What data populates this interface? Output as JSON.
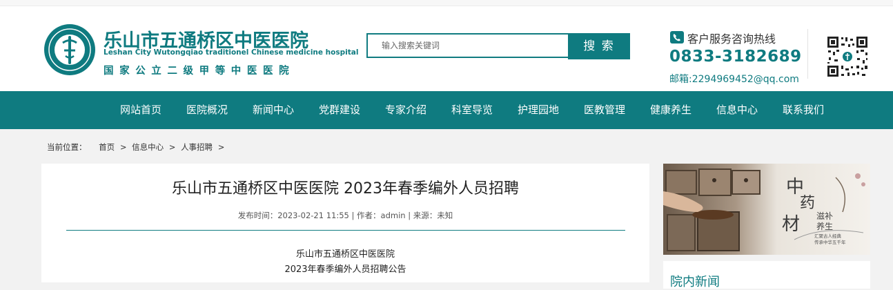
{
  "brand": {
    "name_cn": "乐山市五通桥区中医医院",
    "name_en": "Leshan City Wutongqiao traditionel Chinese medicine hospital",
    "grade": "国家公立二级甲等中医医院",
    "logo_icon": "hospital-logo-icon"
  },
  "search": {
    "placeholder": "输入搜索关键词",
    "value": "",
    "button_label": "搜 索"
  },
  "contact": {
    "hotline_label": "客户服务咨询热线",
    "phone": "0833-3182689",
    "email": "邮箱:2294969452@qq.com",
    "phone_icon": "phone-icon",
    "qr_icon": "qr-code-icon"
  },
  "nav": {
    "items": [
      {
        "label": "网站首页"
      },
      {
        "label": "医院概况"
      },
      {
        "label": "新闻中心"
      },
      {
        "label": "党群建设"
      },
      {
        "label": "专家介绍"
      },
      {
        "label": "科室导览"
      },
      {
        "label": "护理园地"
      },
      {
        "label": "医教管理"
      },
      {
        "label": "健康养生"
      },
      {
        "label": "信息中心"
      },
      {
        "label": "联系我们"
      }
    ]
  },
  "breadcrumb": {
    "label": "当前位置：",
    "items": [
      "首页",
      "信息中心",
      "人事招聘"
    ],
    "separator": ">"
  },
  "article": {
    "title": "乐山市五通桥区中医医院 2023年春季编外人员招聘",
    "meta": "发布时间：2023-02-21 11:55 | 作者：admin | 来源：未知",
    "body": [
      "乐山市五通桥区中医医院",
      "2023年春季编外人员招聘公告"
    ]
  },
  "sidebar": {
    "banner": {
      "title": "中药材",
      "sub": "滋补养生",
      "line1": "汇聚古人经典",
      "line2": "传承中华五千年"
    },
    "news_title": "院内新闻"
  },
  "colors": {
    "accent": "#0f7b80",
    "nav_bg": "#0f7b80",
    "page_bg": "#f2f2f2"
  }
}
